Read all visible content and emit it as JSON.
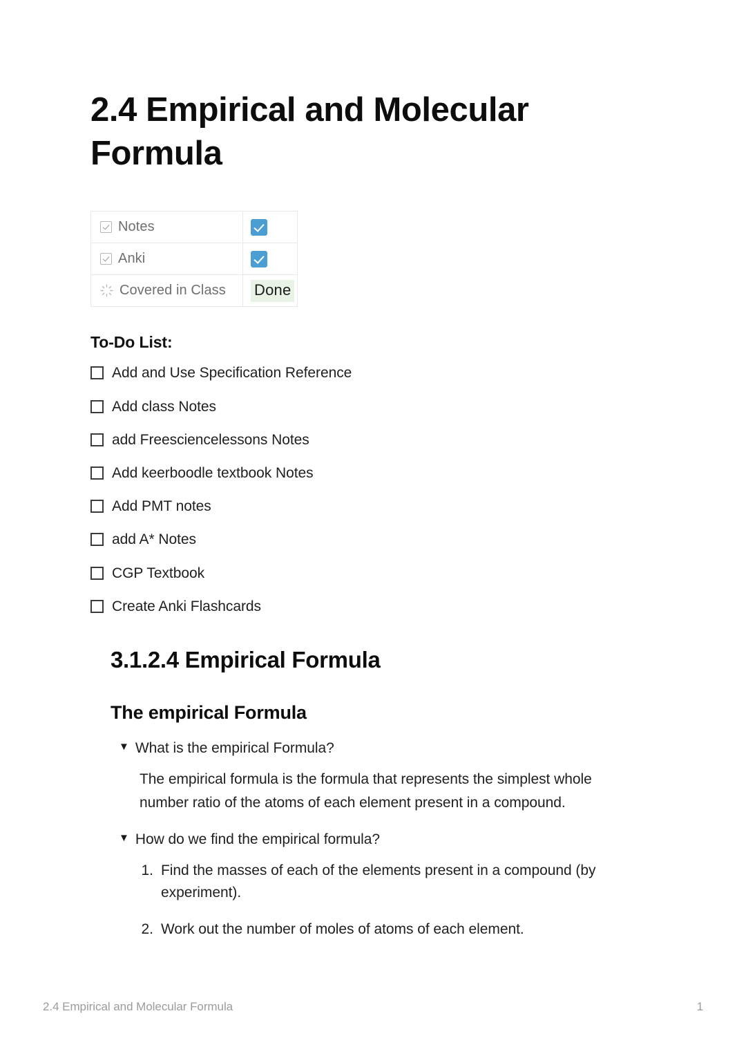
{
  "document": {
    "title": "2.4 Empirical and Molecular Formula"
  },
  "properties": {
    "rows": [
      {
        "icon": "checkbox-checked-icon",
        "label": "Notes",
        "value_type": "checkbox",
        "checked": true
      },
      {
        "icon": "checkbox-checked-icon",
        "label": "Anki",
        "value_type": "checkbox",
        "checked": true
      },
      {
        "icon": "sunburst-icon",
        "label": "Covered in Class",
        "value_type": "tag",
        "tag_label": "Done"
      }
    ]
  },
  "todo": {
    "heading": "To-Do List:",
    "items": [
      {
        "label": "Add and Use Specification Reference",
        "checked": false
      },
      {
        "label": "Add class Notes",
        "checked": false
      },
      {
        "label": "add Freesciencelessons Notes",
        "checked": false
      },
      {
        "label": "Add keerboodle textbook Notes",
        "checked": false
      },
      {
        "label": "Add PMT notes",
        "checked": false
      },
      {
        "label": "add A* Notes",
        "checked": false
      },
      {
        "label": "CGP Textbook",
        "checked": false
      },
      {
        "label": "Create Anki Flashcards",
        "checked": false
      }
    ]
  },
  "sections": {
    "h1": "3.1.2.4 Empirical Formula",
    "h2": "The empirical Formula",
    "toggles": [
      {
        "caret": "▼",
        "title": "What is the empirical Formula?",
        "paragraph": "The empirical formula is the formula that represents the simplest whole number ratio of the atoms of each element present in a compound."
      },
      {
        "caret": "▼",
        "title": "How do we find the empirical formula?",
        "steps": [
          {
            "marker": "1.",
            "text": "Find the masses of each of the elements present in a compound (by experiment)."
          },
          {
            "marker": "2.",
            "text": "Work out the number of moles of atoms of each element."
          }
        ]
      }
    ]
  },
  "footer": {
    "left": "2.4 Empirical and Molecular Formula",
    "right": "1"
  },
  "colors": {
    "checkbox_blue": "#4a9ed4",
    "tag_done_background": "#e8f2e5",
    "table_border": "#e9e9e7",
    "muted_text": "#6f6f6f",
    "footer_text": "#9b9b9b"
  }
}
